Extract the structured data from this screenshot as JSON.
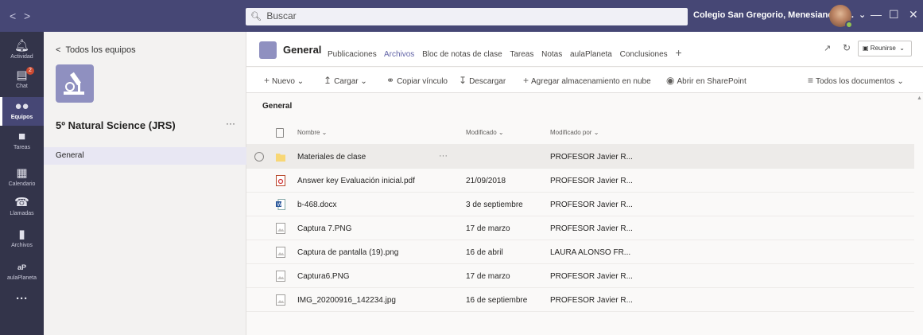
{
  "search": {
    "placeholder": "Buscar"
  },
  "org_name": "Colegio San Gregorio, Menesianos A...",
  "nav": {
    "back": "<",
    "forward": ">"
  },
  "window": {
    "minimize": "—",
    "maximize": "☐",
    "close": "✕"
  },
  "rail": [
    {
      "label": "Actividad",
      "icon": "bell-icon"
    },
    {
      "label": "Chat",
      "icon": "chat-icon",
      "badge": "2"
    },
    {
      "label": "Equipos",
      "icon": "teams-icon"
    },
    {
      "label": "Tareas",
      "icon": "assignments-icon"
    },
    {
      "label": "Calendario",
      "icon": "calendar-icon"
    },
    {
      "label": "Llamadas",
      "icon": "phone-icon"
    },
    {
      "label": "Archivos",
      "icon": "files-icon"
    },
    {
      "label": "aulaPlaneta",
      "icon": "aulaplaneta-icon",
      "glyph": "aP"
    },
    {
      "label": "",
      "icon": "more-icon",
      "glyph": "···"
    }
  ],
  "team": {
    "back_label": "Todos los equipos",
    "name": "5º Natural Science (JRS)",
    "more": "···",
    "channel": "General"
  },
  "channel": {
    "title": "General",
    "tabs": [
      "Publicaciones",
      "Archivos",
      "Bloc de notas de clase",
      "Tareas",
      "Notas",
      "aulaPlaneta",
      "Conclusiones"
    ],
    "active_tab": "Archivos",
    "meet_label": "Reunirse"
  },
  "toolbar": {
    "new": "Nuevo",
    "upload": "Cargar",
    "copy_link": "Copiar vínculo",
    "download": "Descargar",
    "add_storage": "Agregar almacenamiento en nube",
    "open_sharepoint": "Abrir en SharePoint",
    "view": "Todos los documentos"
  },
  "breadcrumb": "General",
  "columns": {
    "name": "Nombre",
    "modified": "Modificado",
    "modified_by": "Modificado por"
  },
  "files": [
    {
      "type": "folder",
      "name": "Materiales de clase",
      "modified": "",
      "by": "PROFESOR Javier R..."
    },
    {
      "type": "pdf",
      "name": "Answer key Evaluación inicial.pdf",
      "modified": "21/09/2018",
      "by": "PROFESOR Javier R..."
    },
    {
      "type": "word",
      "name": "b-468.docx",
      "modified": "3 de septiembre",
      "by": "PROFESOR Javier R..."
    },
    {
      "type": "image",
      "name": "Captura 7.PNG",
      "modified": "17 de marzo",
      "by": "PROFESOR Javier R..."
    },
    {
      "type": "image",
      "name": "Captura de pantalla (19).png",
      "modified": "16 de abril",
      "by": "LAURA ALONSO FR..."
    },
    {
      "type": "image",
      "name": "Captura6.PNG",
      "modified": "17 de marzo",
      "by": "PROFESOR Javier R..."
    },
    {
      "type": "image",
      "name": "IMG_20200916_142234.jpg",
      "modified": "16 de septiembre",
      "by": "PROFESOR Javier R..."
    }
  ],
  "colors": {
    "titlebar": "#464775",
    "rail": "#33344a",
    "accent": "#6264a7"
  }
}
